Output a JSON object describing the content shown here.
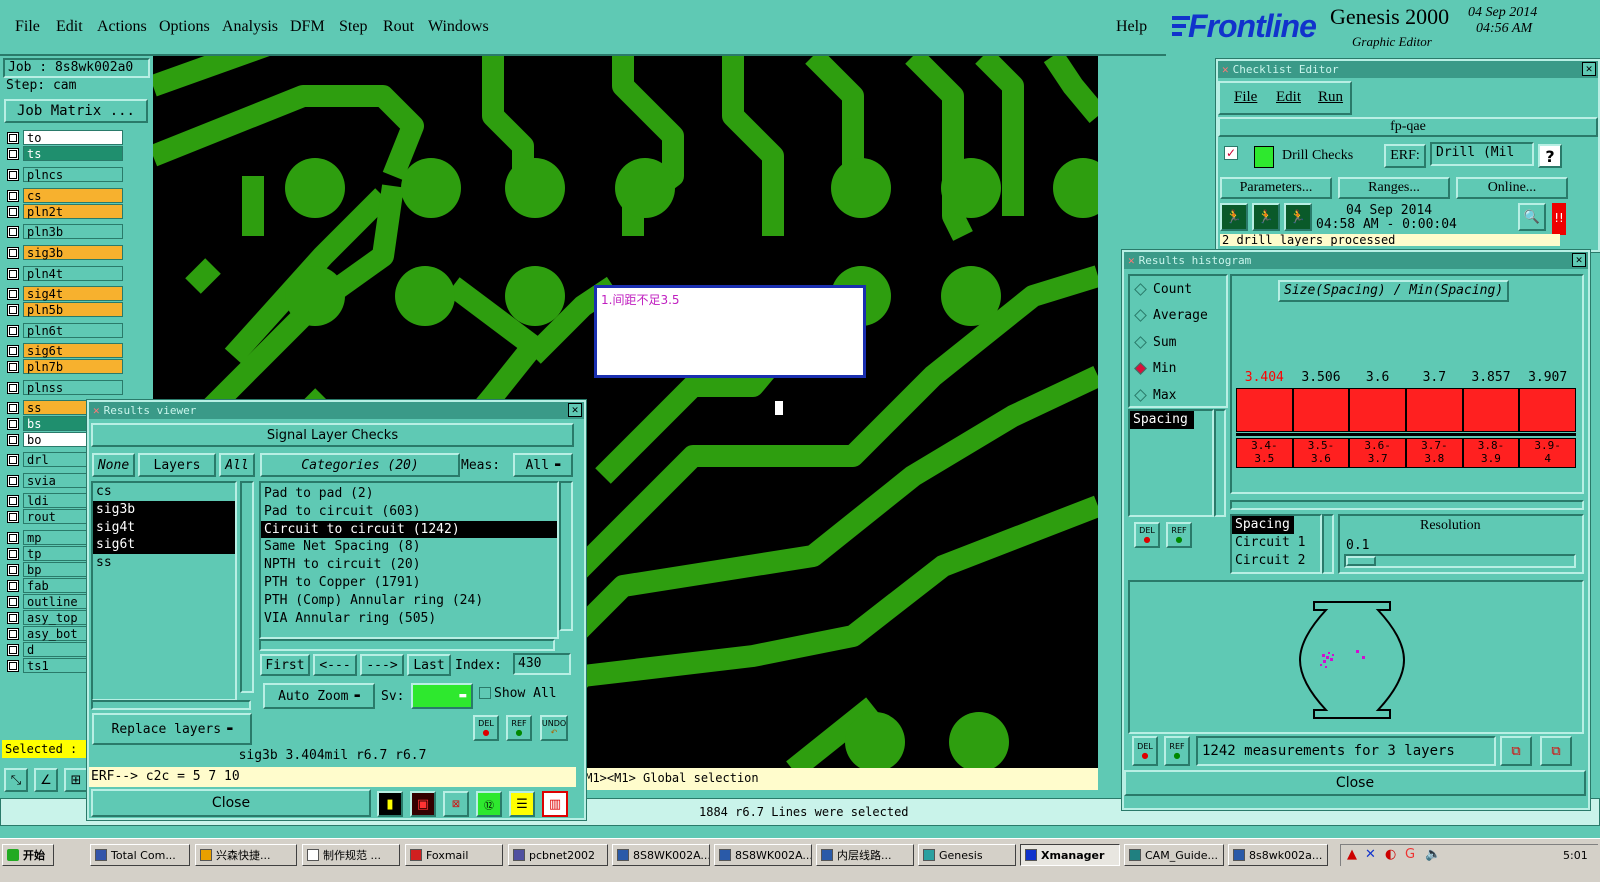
{
  "menubar": {
    "items": [
      "File",
      "Edit",
      "Actions",
      "Options",
      "Analysis",
      "DFM",
      "Step",
      "Rout",
      "Windows"
    ],
    "help": "Help"
  },
  "brand": {
    "logo": "Frontline",
    "product": "Genesis 2000",
    "subtitle": "Graphic Editor",
    "date": "04 Sep 2014",
    "time": "04:56 AM"
  },
  "job": {
    "job_label": "Job : 8s8wk002a0",
    "step_label": "Step: cam",
    "matrix_button": "Job Matrix ..."
  },
  "layers": [
    {
      "name": "to",
      "style": "white"
    },
    {
      "name": "ts",
      "style": "green"
    },
    {
      "name": "plncs",
      "style": "teal"
    },
    {
      "name": "cs",
      "style": "orange"
    },
    {
      "name": "pln2t",
      "style": "orange"
    },
    {
      "name": "pln3b",
      "style": "teal"
    },
    {
      "name": "sig3b",
      "style": "orange"
    },
    {
      "name": "pln4t",
      "style": "teal"
    },
    {
      "name": "sig4t",
      "style": "orange"
    },
    {
      "name": "pln5b",
      "style": "orange"
    },
    {
      "name": "pln6t",
      "style": "teal"
    },
    {
      "name": "sig6t",
      "style": "orange"
    },
    {
      "name": "pln7b",
      "style": "orange"
    },
    {
      "name": "plnss",
      "style": "teal"
    },
    {
      "name": "ss",
      "style": "orange"
    },
    {
      "name": "bs",
      "style": "green"
    },
    {
      "name": "bo",
      "style": "white"
    },
    {
      "name": "drl",
      "style": "teal"
    },
    {
      "name": "svia",
      "style": "teal"
    },
    {
      "name": "ldi",
      "style": "teal"
    },
    {
      "name": "rout",
      "style": "teal"
    },
    {
      "name": "mp",
      "style": "teal"
    },
    {
      "name": "tp",
      "style": "teal"
    },
    {
      "name": "bp",
      "style": "teal"
    },
    {
      "name": "fab",
      "style": "teal"
    },
    {
      "name": "outline",
      "style": "teal"
    },
    {
      "name": "asy_top",
      "style": "teal"
    },
    {
      "name": "asy_bot",
      "style": "teal"
    },
    {
      "name": "d",
      "style": "teal"
    },
    {
      "name": "ts1",
      "style": "teal"
    }
  ],
  "selected_label": "Selected : (",
  "canvas": {
    "note_text": "1.间距不足3.5",
    "mouse_hint": "<M1><M1> Global selection",
    "status": "1884 r6.7 Lines were selected"
  },
  "results_viewer": {
    "title": "Results viewer",
    "heading": "Signal Layer Checks",
    "none_btn": "None",
    "layers_btn": "Layers",
    "all_btn": "All",
    "categories_btn": "Categories (20)",
    "meas_label": "Meas:",
    "meas_value": "All",
    "layer_list": [
      {
        "name": "cs",
        "selected": false
      },
      {
        "name": "sig3b",
        "selected": true
      },
      {
        "name": "sig4t",
        "selected": true
      },
      {
        "name": "sig6t",
        "selected": true
      },
      {
        "name": "ss",
        "selected": false
      }
    ],
    "categories": [
      {
        "name": "Pad to pad (2)",
        "selected": false
      },
      {
        "name": "Pad to circuit (603)",
        "selected": false
      },
      {
        "name": "Circuit to circuit (1242)",
        "selected": true
      },
      {
        "name": "Same Net Spacing (8)",
        "selected": false
      },
      {
        "name": "NPTH to circuit (20)",
        "selected": false
      },
      {
        "name": "PTH to Copper (1791)",
        "selected": false
      },
      {
        "name": "PTH (Comp) Annular ring (24)",
        "selected": false
      },
      {
        "name": "VIA Annular ring (505)",
        "selected": false
      }
    ],
    "first_btn": "First",
    "prev_btn": "<---",
    "next_btn": "--->",
    "last_btn": "Last",
    "index_label": "Index:",
    "index_value": "430",
    "auto_zoom": "Auto Zoom",
    "sv_label": "Sv:",
    "show_all": "Show All",
    "replace_layers": "Replace layers",
    "del_btn": "DEL",
    "ref_btn": "REF",
    "undo_btn": "UNDO",
    "status_line": "sig3b 3.404mil  r6.7  r6.7",
    "erf_line": "ERF--> c2c = 5 7 10",
    "close_btn": "Close"
  },
  "checklist": {
    "title": "Checklist Editor",
    "menu": [
      "File",
      "Edit",
      "Run"
    ],
    "name": "fp-qae",
    "check_name": "Drill Checks",
    "erf_label": "ERF:",
    "erf_value": "Drill (Mil",
    "help": "?",
    "params_btn": "Parameters...",
    "ranges_btn": "Ranges...",
    "online_btn": "Online...",
    "run_date": "04 Sep 2014",
    "run_time": "04:58 AM - 0:00:04",
    "report_line": "2 drill layers processed"
  },
  "histogram": {
    "title": "Results histogram",
    "modes": [
      {
        "label": "Count",
        "active": false
      },
      {
        "label": "Average",
        "active": false
      },
      {
        "label": "Sum",
        "active": false
      },
      {
        "label": "Min",
        "active": true
      },
      {
        "label": "Max",
        "active": false
      }
    ],
    "meas_list": [
      "Spacing"
    ],
    "chart_title": "Size(Spacing) / Min(Spacing)",
    "bins": [
      {
        "range": "3.4-3.5",
        "min": "3.404",
        "highlight": true
      },
      {
        "range": "3.5-3.6",
        "min": "3.506",
        "highlight": false
      },
      {
        "range": "3.6-3.7",
        "min": "3.6",
        "highlight": false
      },
      {
        "range": "3.7-3.8",
        "min": "3.7",
        "highlight": false
      },
      {
        "range": "3.8-3.9",
        "min": "3.857",
        "highlight": false
      },
      {
        "range": "3.9-4",
        "min": "3.907",
        "highlight": false
      }
    ],
    "range_labels_top": [
      "3.4-",
      "3.5-",
      "3.6-",
      "3.7-",
      "3.8-",
      "3.9-"
    ],
    "range_labels_bot": [
      "3.5",
      "3.6",
      "3.7",
      "3.8",
      "3.9",
      "4"
    ],
    "filter_list": [
      "Spacing",
      "Circuit 1",
      "Circuit 2"
    ],
    "resolution_label": "Resolution",
    "resolution_value": "0.1",
    "summary": "1242 measurements for 3 layers",
    "del_btn": "DEL",
    "ref_btn": "REF",
    "close_btn": "Close"
  },
  "taskbar": {
    "start": "开始",
    "tasks": [
      "Total Com...",
      "兴森快捷...",
      "制作规范 ...",
      "Foxmail",
      "pcbnet2002",
      "8S8WK002A...",
      "8S8WK002A...",
      "内层线路...",
      "Genesis",
      "Xmanager",
      "CAM_Guide...",
      "8s8wk002a..."
    ],
    "clock": "5:01"
  },
  "colors": {
    "panel": "#5fc9b4",
    "copper": "#2e9e0f",
    "hist_bar": "#ff2020",
    "highlight_value": "#ff0000",
    "orange_layer": "#f7b12e"
  }
}
